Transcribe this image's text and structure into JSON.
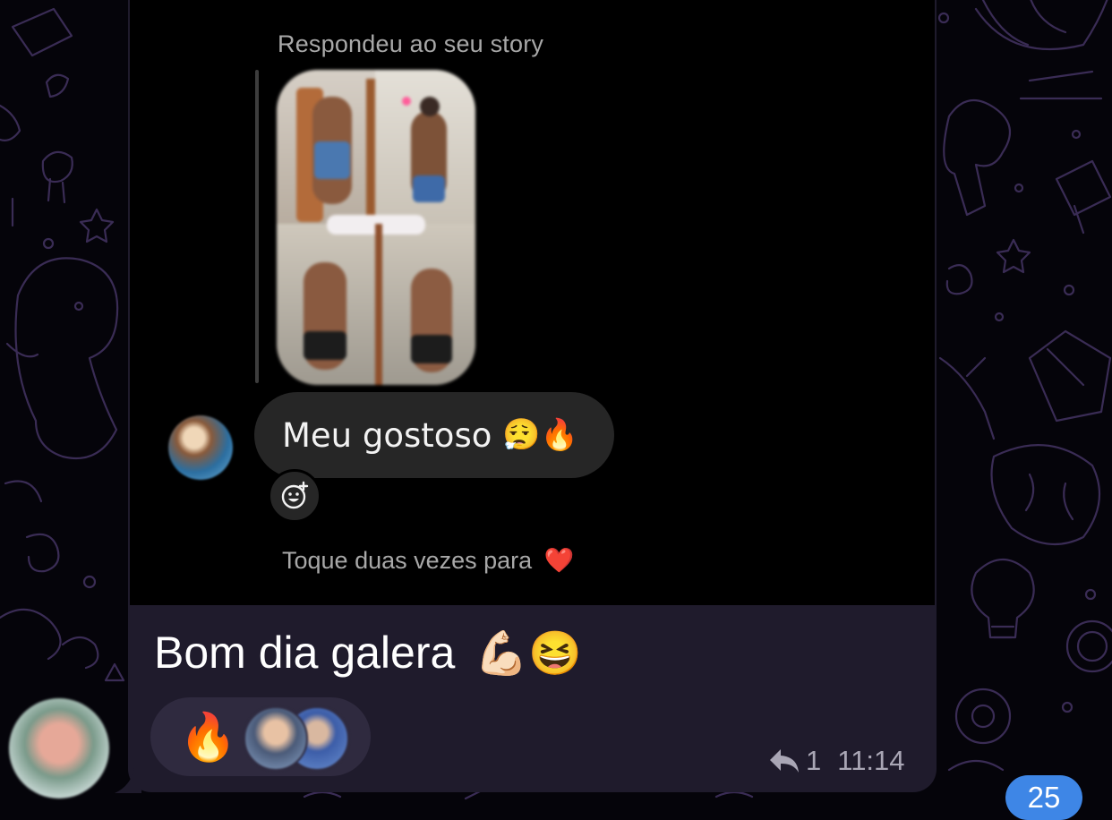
{
  "story_reply": {
    "label": "Respondeu ao seu story",
    "message_text": "Meu gostoso",
    "message_emojis": "😮‍💨🔥",
    "tap_hint": "Toque duas vezes para",
    "tap_hint_heart": "❤️"
  },
  "message": {
    "caption_text": "Bom dia galera",
    "caption_emojis": "💪🏻😆",
    "reaction_emoji": "🔥",
    "reply_count": "1",
    "time": "11:14"
  },
  "unread_badge": "25",
  "colors": {
    "bubble": "#1f1b2c",
    "reaction_pill": "#2f2a3f",
    "badge": "#3e86e6",
    "doodle_stroke": "#3a2c55"
  }
}
